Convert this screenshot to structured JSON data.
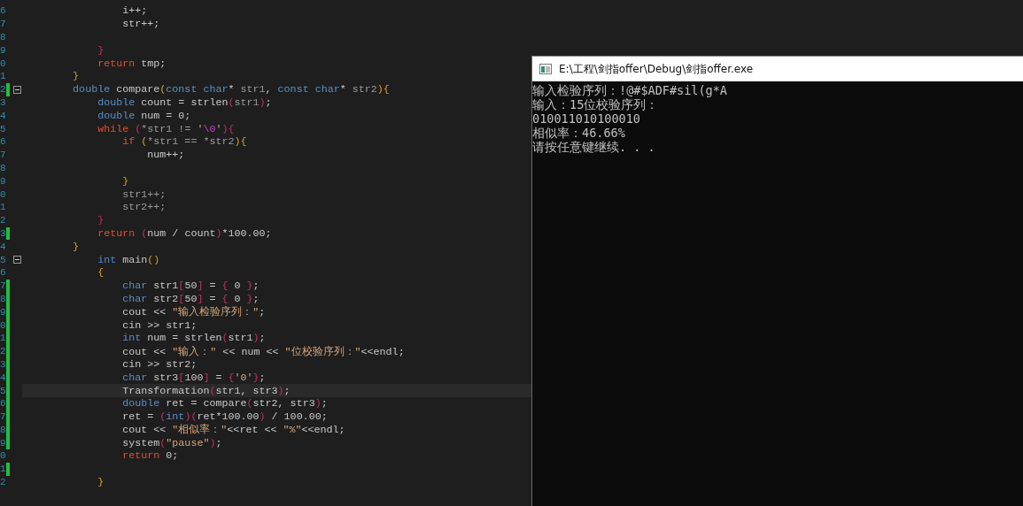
{
  "editor": {
    "lines": [
      {
        "number": "6",
        "changed": false,
        "fold": false,
        "current": false,
        "tokens": [
          {
            "kind": "plain",
            "text": "                i++;"
          }
        ]
      },
      {
        "number": "7",
        "changed": false,
        "fold": false,
        "current": false,
        "tokens": [
          {
            "kind": "plain",
            "text": "                str++;"
          }
        ]
      },
      {
        "number": "8",
        "changed": false,
        "fold": false,
        "current": false
      },
      {
        "number": "9",
        "changed": false,
        "fold": false,
        "current": false,
        "tokens": [
          {
            "kind": "punct",
            "text": "            }"
          }
        ]
      },
      {
        "number": "0",
        "changed": false,
        "fold": false,
        "current": false,
        "tokens": [
          {
            "kind": "control",
            "text": "            return"
          },
          {
            "kind": "plain",
            "text": " tmp;"
          }
        ]
      },
      {
        "number": "1",
        "changed": false,
        "fold": false,
        "current": false,
        "tokens": [
          {
            "kind": "brace",
            "text": "        }"
          }
        ]
      },
      {
        "number": "2",
        "changed": true,
        "fold": true,
        "current": false,
        "tokens": [
          {
            "kind": "keyword",
            "text": "        double"
          },
          {
            "kind": "plain",
            "text": " compare"
          },
          {
            "kind": "brace",
            "text": "("
          },
          {
            "kind": "keyword",
            "text": "const char"
          },
          {
            "kind": "plain",
            "text": "* "
          },
          {
            "kind": "param",
            "text": "str1"
          },
          {
            "kind": "plain",
            "text": ", "
          },
          {
            "kind": "keyword",
            "text": "const char"
          },
          {
            "kind": "plain",
            "text": "* "
          },
          {
            "kind": "param",
            "text": "str2"
          },
          {
            "kind": "brace",
            "text": "){"
          }
        ]
      },
      {
        "number": "3",
        "changed": false,
        "fold": false,
        "current": false,
        "tokens": [
          {
            "kind": "keyword",
            "text": "            double"
          },
          {
            "kind": "plain",
            "text": " count = strlen"
          },
          {
            "kind": "punct",
            "text": "("
          },
          {
            "kind": "param",
            "text": "str1"
          },
          {
            "kind": "punct",
            "text": ")"
          },
          {
            "kind": "plain",
            "text": ";"
          }
        ]
      },
      {
        "number": "4",
        "changed": false,
        "fold": false,
        "current": false,
        "tokens": [
          {
            "kind": "keyword",
            "text": "            double"
          },
          {
            "kind": "plain",
            "text": " num = 0;"
          }
        ]
      },
      {
        "number": "5",
        "changed": false,
        "fold": false,
        "current": false,
        "tokens": [
          {
            "kind": "control",
            "text": "            while"
          },
          {
            "kind": "punct",
            "text": " ("
          },
          {
            "kind": "param",
            "text": "*str1 != "
          },
          {
            "kind": "string",
            "text": "'"
          },
          {
            "kind": "escape",
            "text": "\\0"
          },
          {
            "kind": "string",
            "text": "'"
          },
          {
            "kind": "punct",
            "text": "){"
          }
        ]
      },
      {
        "number": "6",
        "changed": false,
        "fold": false,
        "current": false,
        "tokens": [
          {
            "kind": "control",
            "text": "                if"
          },
          {
            "kind": "brace",
            "text": " ("
          },
          {
            "kind": "param",
            "text": "*str1 == *str2"
          },
          {
            "kind": "brace",
            "text": "){"
          }
        ]
      },
      {
        "number": "7",
        "changed": false,
        "fold": false,
        "current": false,
        "tokens": [
          {
            "kind": "plain",
            "text": "                    num++;"
          }
        ]
      },
      {
        "number": "8",
        "changed": false,
        "fold": false,
        "current": false
      },
      {
        "number": "9",
        "changed": false,
        "fold": false,
        "current": false,
        "tokens": [
          {
            "kind": "brace",
            "text": "                }"
          }
        ]
      },
      {
        "number": "0",
        "changed": false,
        "fold": false,
        "current": false,
        "tokens": [
          {
            "kind": "param",
            "text": "                str1++;"
          }
        ]
      },
      {
        "number": "1",
        "changed": false,
        "fold": false,
        "current": false,
        "tokens": [
          {
            "kind": "param",
            "text": "                str2++;"
          }
        ]
      },
      {
        "number": "2",
        "changed": false,
        "fold": false,
        "current": false,
        "tokens": [
          {
            "kind": "punct",
            "text": "            }"
          }
        ]
      },
      {
        "number": "3",
        "changed": true,
        "fold": false,
        "current": false,
        "tokens": [
          {
            "kind": "control",
            "text": "            return"
          },
          {
            "kind": "punct",
            "text": " ("
          },
          {
            "kind": "plain",
            "text": "num / count"
          },
          {
            "kind": "punct",
            "text": ")"
          },
          {
            "kind": "plain",
            "text": "*100.00;"
          }
        ]
      },
      {
        "number": "4",
        "changed": false,
        "fold": false,
        "current": false,
        "tokens": [
          {
            "kind": "brace",
            "text": "        }"
          }
        ]
      },
      {
        "number": "5",
        "changed": false,
        "fold": true,
        "current": false,
        "tokens": [
          {
            "kind": "keyword",
            "text": "            int"
          },
          {
            "kind": "plain",
            "text": " main"
          },
          {
            "kind": "brace",
            "text": "()"
          }
        ]
      },
      {
        "number": "6",
        "changed": false,
        "fold": false,
        "current": false,
        "tokens": [
          {
            "kind": "brace",
            "text": "            {"
          }
        ]
      },
      {
        "number": "7",
        "changed": true,
        "fold": false,
        "current": false,
        "tokens": [
          {
            "kind": "keyword",
            "text": "                char"
          },
          {
            "kind": "plain",
            "text": " str1"
          },
          {
            "kind": "punct",
            "text": "["
          },
          {
            "kind": "plain",
            "text": "50"
          },
          {
            "kind": "punct",
            "text": "]"
          },
          {
            "kind": "plain",
            "text": " = "
          },
          {
            "kind": "punct",
            "text": "{"
          },
          {
            "kind": "plain",
            "text": " 0 "
          },
          {
            "kind": "punct",
            "text": "}"
          },
          {
            "kind": "plain",
            "text": ";"
          }
        ]
      },
      {
        "number": "8",
        "changed": true,
        "fold": false,
        "current": false,
        "tokens": [
          {
            "kind": "keyword",
            "text": "                char"
          },
          {
            "kind": "plain",
            "text": " str2"
          },
          {
            "kind": "punct",
            "text": "["
          },
          {
            "kind": "plain",
            "text": "50"
          },
          {
            "kind": "punct",
            "text": "]"
          },
          {
            "kind": "plain",
            "text": " = "
          },
          {
            "kind": "punct",
            "text": "{"
          },
          {
            "kind": "plain",
            "text": " 0 "
          },
          {
            "kind": "punct",
            "text": "}"
          },
          {
            "kind": "plain",
            "text": ";"
          }
        ]
      },
      {
        "number": "9",
        "changed": true,
        "fold": false,
        "current": false,
        "tokens": [
          {
            "kind": "plain",
            "text": "                cout << "
          },
          {
            "kind": "string",
            "text": "\"输入检验序列：\""
          },
          {
            "kind": "plain",
            "text": ";"
          }
        ]
      },
      {
        "number": "0",
        "changed": true,
        "fold": false,
        "current": false,
        "tokens": [
          {
            "kind": "plain",
            "text": "                cin >> str1;"
          }
        ]
      },
      {
        "number": "1",
        "changed": true,
        "fold": false,
        "current": false,
        "tokens": [
          {
            "kind": "keyword",
            "text": "                int"
          },
          {
            "kind": "plain",
            "text": " num = strlen"
          },
          {
            "kind": "punct",
            "text": "("
          },
          {
            "kind": "plain",
            "text": "str1"
          },
          {
            "kind": "punct",
            "text": ")"
          },
          {
            "kind": "plain",
            "text": ";"
          }
        ]
      },
      {
        "number": "2",
        "changed": true,
        "fold": false,
        "current": false,
        "tokens": [
          {
            "kind": "plain",
            "text": "                cout << "
          },
          {
            "kind": "string",
            "text": "\"输入：\""
          },
          {
            "kind": "plain",
            "text": " << num << "
          },
          {
            "kind": "string",
            "text": "\"位校验序列：\""
          },
          {
            "kind": "plain",
            "text": "<<endl;"
          }
        ]
      },
      {
        "number": "3",
        "changed": true,
        "fold": false,
        "current": false,
        "tokens": [
          {
            "kind": "plain",
            "text": "                cin >> str2;"
          }
        ]
      },
      {
        "number": "4",
        "changed": true,
        "fold": false,
        "current": false,
        "tokens": [
          {
            "kind": "keyword",
            "text": "                char"
          },
          {
            "kind": "plain",
            "text": " str3"
          },
          {
            "kind": "punct",
            "text": "["
          },
          {
            "kind": "plain",
            "text": "100"
          },
          {
            "kind": "punct",
            "text": "]"
          },
          {
            "kind": "plain",
            "text": " = "
          },
          {
            "kind": "punct",
            "text": "{"
          },
          {
            "kind": "string",
            "text": "'0'"
          },
          {
            "kind": "punct",
            "text": "}"
          },
          {
            "kind": "plain",
            "text": ";"
          }
        ]
      },
      {
        "number": "5",
        "changed": true,
        "fold": false,
        "current": true,
        "tokens": [
          {
            "kind": "plain",
            "text": "                Transformation"
          },
          {
            "kind": "punct",
            "text": "("
          },
          {
            "kind": "plain",
            "text": "str1, str3"
          },
          {
            "kind": "punct",
            "text": ")"
          },
          {
            "kind": "plain",
            "text": ";"
          }
        ]
      },
      {
        "number": "6",
        "changed": true,
        "fold": false,
        "current": false,
        "tokens": [
          {
            "kind": "keyword",
            "text": "                double"
          },
          {
            "kind": "plain",
            "text": " ret = compare"
          },
          {
            "kind": "punct",
            "text": "("
          },
          {
            "kind": "plain",
            "text": "str2, str3"
          },
          {
            "kind": "punct",
            "text": ")"
          },
          {
            "kind": "plain",
            "text": ";"
          }
        ]
      },
      {
        "number": "7",
        "changed": true,
        "fold": false,
        "current": false,
        "tokens": [
          {
            "kind": "plain",
            "text": "                ret = "
          },
          {
            "kind": "punct",
            "text": "("
          },
          {
            "kind": "keyword",
            "text": "int"
          },
          {
            "kind": "punct",
            "text": ")("
          },
          {
            "kind": "plain",
            "text": "ret*100.00"
          },
          {
            "kind": "punct",
            "text": ")"
          },
          {
            "kind": "plain",
            "text": " / 100.00;"
          }
        ]
      },
      {
        "number": "8",
        "changed": true,
        "fold": false,
        "current": false,
        "tokens": [
          {
            "kind": "plain",
            "text": "                cout << "
          },
          {
            "kind": "string",
            "text": "\"相似率：\""
          },
          {
            "kind": "plain",
            "text": "<<ret << "
          },
          {
            "kind": "string",
            "text": "\"%\""
          },
          {
            "kind": "plain",
            "text": "<<endl;"
          }
        ]
      },
      {
        "number": "9",
        "changed": true,
        "fold": false,
        "current": false,
        "tokens": [
          {
            "kind": "plain",
            "text": "                system"
          },
          {
            "kind": "punct",
            "text": "("
          },
          {
            "kind": "string",
            "text": "\"pause\""
          },
          {
            "kind": "punct",
            "text": ")"
          },
          {
            "kind": "plain",
            "text": ";"
          }
        ]
      },
      {
        "number": "0",
        "changed": false,
        "fold": false,
        "current": false,
        "tokens": [
          {
            "kind": "control",
            "text": "                return"
          },
          {
            "kind": "plain",
            "text": " 0;"
          }
        ]
      },
      {
        "number": "1",
        "changed": true,
        "fold": false,
        "current": false
      },
      {
        "number": "2",
        "changed": false,
        "fold": false,
        "current": false,
        "tokens": [
          {
            "kind": "brace",
            "text": "            }"
          }
        ]
      }
    ]
  },
  "console": {
    "title": "E:\\工程\\剑指offer\\Debug\\剑指offer.exe",
    "lines": [
      "输入检验序列：!@#$ADF#sil(g*A",
      "输入：15位校验序列：",
      "010011010100010",
      "相似率：46.66%",
      "请按任意键继续. . ."
    ]
  }
}
